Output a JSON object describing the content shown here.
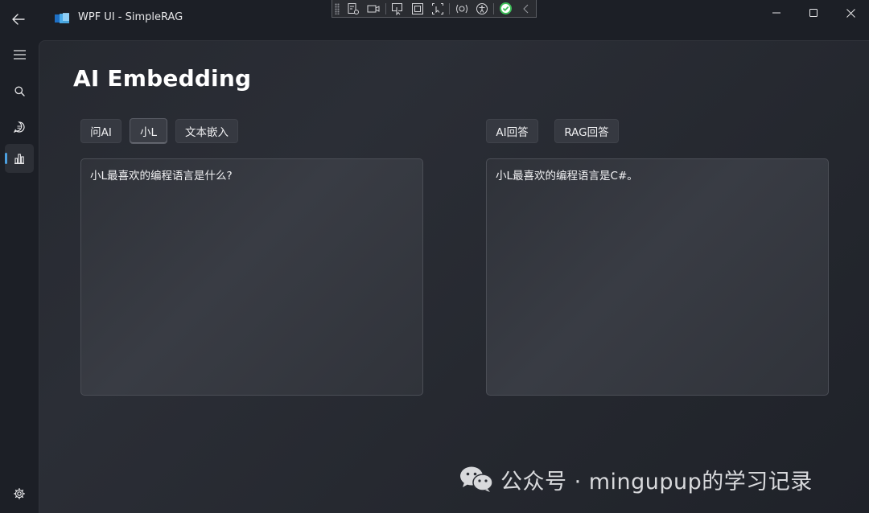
{
  "window": {
    "title": "WPF UI - SimpleRAG"
  },
  "page": {
    "title": "AI Embedding"
  },
  "toolbar_left": {
    "ask_ai_label": "问AI",
    "xiaol_label": "小L",
    "text_embed_label": "文本嵌入"
  },
  "toolbar_right": {
    "ai_answer_label": "AI回答",
    "rag_answer_label": "RAG回答"
  },
  "input_box": {
    "value": "小L最喜欢的编程语言是什么?"
  },
  "output_box": {
    "value": "小L最喜欢的编程语言是C#。"
  },
  "watermark": {
    "text": "公众号 · mingupup的学习记录"
  },
  "nav": {
    "items": [
      "menu-icon",
      "search-icon",
      "chat-icon",
      "chart-icon"
    ],
    "footer": "settings-icon",
    "active_index": 3
  },
  "colors": {
    "accent": "#4ca0e0",
    "background": "#1c1f26",
    "button": "#363941"
  }
}
